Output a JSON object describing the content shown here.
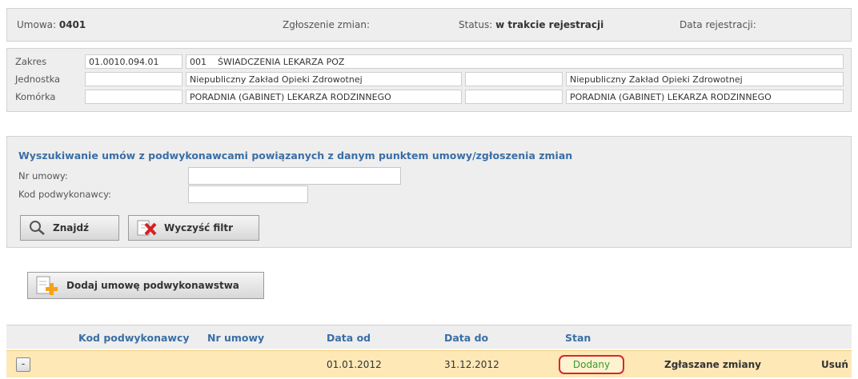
{
  "header": {
    "umowa_label": "Umowa:",
    "umowa_value": "0401",
    "zgloszenie_label": "Zgłoszenie zmian:",
    "status_label": "Status:",
    "status_value": "w trakcie rejestracji",
    "data_rejestracji_label": "Data rejestracji:"
  },
  "details": {
    "zakres_label": "Zakres",
    "zakres_code": "01.0010.094.01",
    "zakres_num": "001",
    "zakres_desc": "ŚWIADCZENIA LEKARZA POZ",
    "jednostka_label": "Jednostka",
    "jednostka_name_1": "Niepubliczny Zakład Opieki Zdrowotnej",
    "jednostka_name_2": "Niepubliczny Zakład Opieki Zdrowotnej",
    "komorka_label": "Komórka",
    "komorka_name_1": "PORADNIA (GABINET) LEKARZA RODZINNEGO",
    "komorka_name_2": "PORADNIA (GABINET) LEKARZA RODZINNEGO"
  },
  "search": {
    "title": "Wyszukiwanie umów z podwykonawcami powiązanych z danym punktem umowy/zgłoszenia zmian",
    "nr_umowy_label": "Nr umowy:",
    "nr_umowy_value": "",
    "kod_label": "Kod podwykonawcy:",
    "kod_value": "",
    "find_label": "Znajdź",
    "clear_label": "Wyczyść filtr"
  },
  "add_button_label": "Dodaj umowę podwykonawstwa",
  "table": {
    "columns": [
      "Kod podwykonawcy",
      "Nr umowy",
      "Data od",
      "Data do",
      "Stan"
    ],
    "rows": [
      {
        "expander": "-",
        "kod": "",
        "nr": "",
        "data_od": "01.01.2012",
        "data_do": "31.12.2012",
        "stan": "Dodany",
        "zmiany_link": "Zgłaszane zmiany",
        "usun_link": "Usuń"
      }
    ]
  },
  "colors": {
    "accent_blue": "#3a6ea5",
    "row_highlight": "#fde8b6",
    "status_border": "#d9262c",
    "status_text": "#3a9a2a"
  }
}
